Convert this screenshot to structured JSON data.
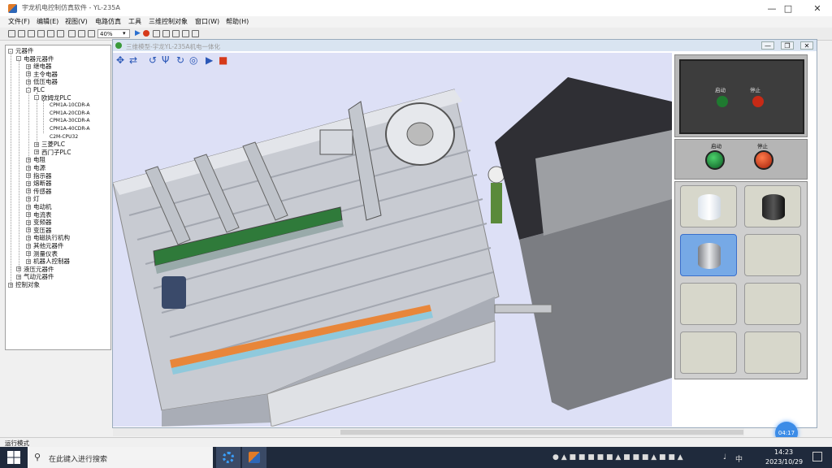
{
  "window": {
    "title": "宇龙机电控制仿真软件 - YL-235A"
  },
  "menu": [
    "文件(F)",
    "编辑(E)",
    "视图(V)",
    "电路仿真",
    "工具",
    "三维控制对象",
    "窗口(W)",
    "帮助(H)"
  ],
  "toolbar": {
    "zoom": "40%"
  },
  "tree": [
    {
      "label": "元器件",
      "level": 0,
      "exp": "-"
    },
    {
      "label": "电器元器件",
      "level": 1,
      "exp": "-"
    },
    {
      "label": "继电器",
      "level": 2,
      "exp": "+"
    },
    {
      "label": "主令电器",
      "level": 2,
      "exp": "+"
    },
    {
      "label": "低压电器",
      "level": 2,
      "exp": "+"
    },
    {
      "label": "PLC",
      "level": 2,
      "exp": "-"
    },
    {
      "label": "欧姆龙PLC",
      "level": 3,
      "exp": "-"
    },
    {
      "label": "CPM1A-10CDR-A",
      "level": 4,
      "exp": ""
    },
    {
      "label": "CPM1A-20CDR-A",
      "level": 4,
      "exp": ""
    },
    {
      "label": "CPM1A-30CDR-A",
      "level": 4,
      "exp": ""
    },
    {
      "label": "CPM1A-40CDR-A",
      "level": 4,
      "exp": ""
    },
    {
      "label": "C2M-CPU32",
      "level": 4,
      "exp": ""
    },
    {
      "label": "三菱PLC",
      "level": 3,
      "exp": "+"
    },
    {
      "label": "西门子PLC",
      "level": 3,
      "exp": "+"
    },
    {
      "label": "电阻",
      "level": 2,
      "exp": "+"
    },
    {
      "label": "电源",
      "level": 2,
      "exp": "+"
    },
    {
      "label": "指示器",
      "level": 2,
      "exp": "+"
    },
    {
      "label": "熔断器",
      "level": 2,
      "exp": "+"
    },
    {
      "label": "传感器",
      "level": 2,
      "exp": "+"
    },
    {
      "label": "灯",
      "level": 2,
      "exp": "+"
    },
    {
      "label": "电动机",
      "level": 2,
      "exp": "+"
    },
    {
      "label": "电流表",
      "level": 2,
      "exp": "+"
    },
    {
      "label": "变频器",
      "level": 2,
      "exp": "+"
    },
    {
      "label": "变压器",
      "level": 2,
      "exp": "+"
    },
    {
      "label": "电磁执行机构",
      "level": 2,
      "exp": "+"
    },
    {
      "label": "其他元器件",
      "level": 2,
      "exp": "+"
    },
    {
      "label": "测量仪表",
      "level": 2,
      "exp": "+"
    },
    {
      "label": "机器人控制器",
      "level": 2,
      "exp": "+"
    },
    {
      "label": "液压元器件",
      "level": 1,
      "exp": "+"
    },
    {
      "label": "气动元器件",
      "level": 1,
      "exp": "+"
    },
    {
      "label": "控制对象",
      "level": 0,
      "exp": "+"
    }
  ],
  "child_window": {
    "title": "三维模型-宇龙YL-235A机电一体化"
  },
  "control": {
    "start": "启动",
    "stop": "停止"
  },
  "statusbar": {
    "text": "运行模式"
  },
  "timer": "04:17",
  "taskbar": {
    "search_placeholder": "在此键入进行搜索",
    "ime": "中",
    "time": "14:23",
    "date": "2023/10/29"
  },
  "colors": {
    "start_green": "#1f8a3a",
    "stop_red": "#d63a1a",
    "selected_slot": "#76a9e6",
    "view_bg": "#dde0f6"
  }
}
